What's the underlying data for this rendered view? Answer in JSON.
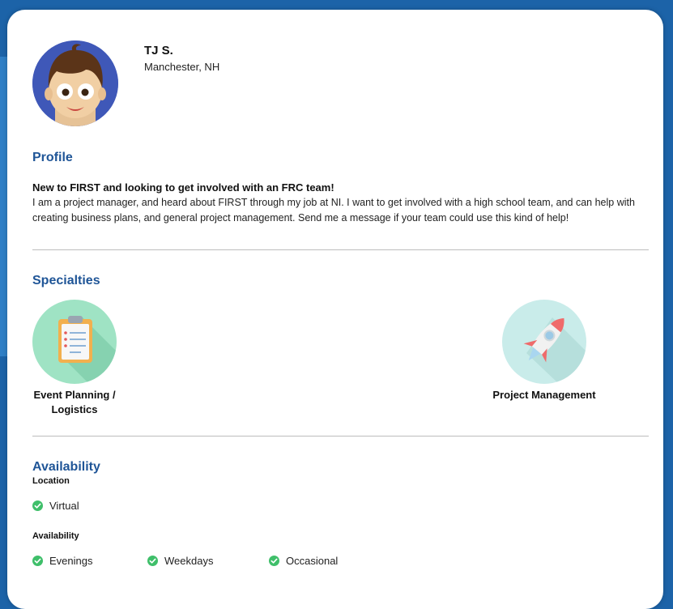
{
  "profile": {
    "name": "TJ S.",
    "location": "Manchester, NH"
  },
  "sections": {
    "profile_title": "Profile",
    "specialties_title": "Specialties",
    "availability_title": "Availability"
  },
  "bio": {
    "heading": "New to FIRST and looking to get involved with an FRC team!",
    "text": "I am a project manager, and heard about FIRST through my job at NI. I want to get involved with a high school team, and can help with creating business plans, and general project management. Send me a message if your team could use this kind of help!"
  },
  "specialties": [
    {
      "label": "Event Planning / Logistics",
      "icon": "clipboard-icon"
    },
    {
      "label": "Project Management",
      "icon": "rocket-icon"
    }
  ],
  "availability": {
    "location_label": "Location",
    "location_items": [
      "Virtual"
    ],
    "availability_label": "Availability",
    "availability_items": [
      "Evenings",
      "Weekdays",
      "Occasional"
    ]
  },
  "colors": {
    "accent": "#1f5597",
    "check": "#3fbf6a",
    "background": "#1c63a8"
  }
}
